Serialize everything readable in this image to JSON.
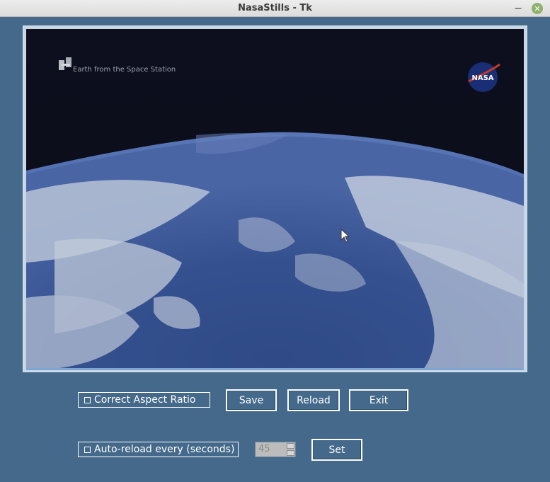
{
  "window": {
    "title": "NasaStills - Tk",
    "minimize_glyph": "−",
    "close_glyph": "✕"
  },
  "image": {
    "caption": "Earth from the Space Station",
    "logo_text": "NASA"
  },
  "controls": {
    "aspect_label": "Correct Aspect Ratio",
    "save_label": "Save",
    "reload_label": "Reload",
    "exit_label": "Exit",
    "autoreload_label": "Auto-reload every (seconds)",
    "interval_value": "45",
    "set_label": "Set"
  },
  "colors": {
    "background": "#44698a",
    "text": "#ffffff"
  },
  "icons": {
    "iss": "iss-satellite-icon",
    "logo": "nasa-logo-icon",
    "cursor": "mouse-cursor-icon"
  }
}
